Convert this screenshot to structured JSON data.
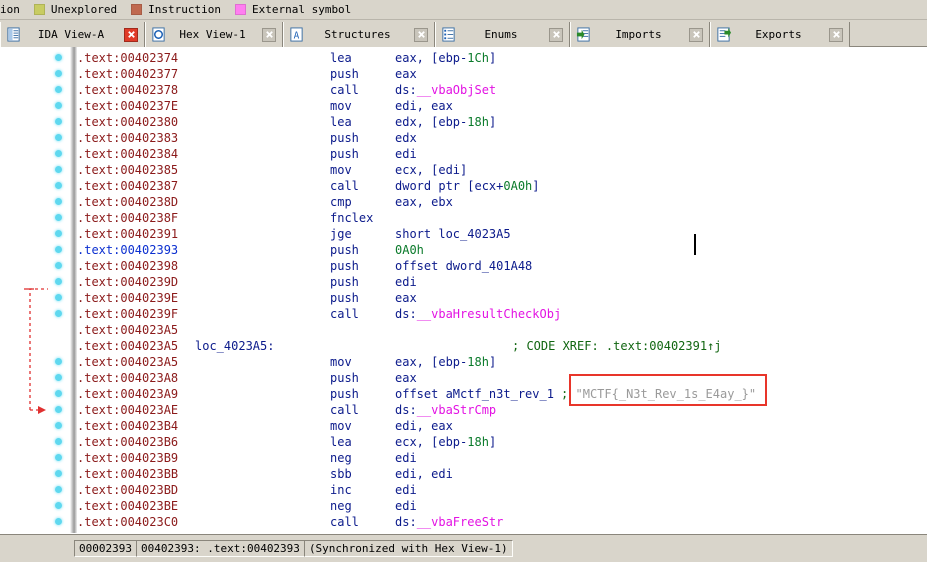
{
  "legend": {
    "truncated_text": "ion",
    "items": [
      {
        "label": "Unexplored",
        "color": "#c8cc62"
      },
      {
        "label": "Instruction",
        "color": "#c0694f"
      },
      {
        "label": "External symbol",
        "color": "#ff7ef0"
      }
    ]
  },
  "tabs": [
    {
      "label": "IDA View-A",
      "icon": "document-list-icon",
      "active": true,
      "close_label": "x"
    },
    {
      "label": "Hex View-1",
      "icon": "hex-circle-icon",
      "active": false,
      "close_label": "x"
    },
    {
      "label": "Structures",
      "icon": "letter-a-icon",
      "active": false,
      "close_label": "x"
    },
    {
      "label": "Enums",
      "icon": "enum-list-icon",
      "active": false,
      "close_label": "x"
    },
    {
      "label": "Imports",
      "icon": "imports-arrow-icon",
      "active": false,
      "close_label": "x"
    },
    {
      "label": "Exports",
      "icon": "exports-arrow-icon",
      "active": false,
      "close_label": "x"
    }
  ],
  "disassembly": {
    "segment": ".text",
    "flag_string": "\"MCTF{_N3t_Rev_1s_E4ay_}\"",
    "xref_comment": "; CODE XREF: .text:00402391↑j",
    "lines": [
      {
        "addr": ".text:00402374",
        "mnem": "lea",
        "ops": [
          {
            "t": "eax, [ebp-",
            "c": "plain"
          },
          {
            "t": "1Ch",
            "c": "num"
          },
          {
            "t": "]",
            "c": "plain"
          }
        ]
      },
      {
        "addr": ".text:00402377",
        "mnem": "push",
        "ops": [
          {
            "t": "eax",
            "c": "plain"
          }
        ]
      },
      {
        "addr": ".text:00402378",
        "mnem": "call",
        "ops": [
          {
            "t": "ds:",
            "c": "plain"
          },
          {
            "t": "__vbaObjSet",
            "c": "ext"
          }
        ]
      },
      {
        "addr": ".text:0040237E",
        "mnem": "mov",
        "ops": [
          {
            "t": "edi, eax",
            "c": "plain"
          }
        ]
      },
      {
        "addr": ".text:00402380",
        "mnem": "lea",
        "ops": [
          {
            "t": "edx, [ebp-",
            "c": "plain"
          },
          {
            "t": "18h",
            "c": "num"
          },
          {
            "t": "]",
            "c": "plain"
          }
        ]
      },
      {
        "addr": ".text:00402383",
        "mnem": "push",
        "ops": [
          {
            "t": "edx",
            "c": "plain"
          }
        ]
      },
      {
        "addr": ".text:00402384",
        "mnem": "push",
        "ops": [
          {
            "t": "edi",
            "c": "plain"
          }
        ]
      },
      {
        "addr": ".text:00402385",
        "mnem": "mov",
        "ops": [
          {
            "t": "ecx, [edi]",
            "c": "plain"
          }
        ]
      },
      {
        "addr": ".text:00402387",
        "mnem": "call",
        "ops": [
          {
            "t": "dword ptr [ecx+",
            "c": "plain"
          },
          {
            "t": "0A0h",
            "c": "num"
          },
          {
            "t": "]",
            "c": "plain"
          }
        ]
      },
      {
        "addr": ".text:0040238D",
        "mnem": "cmp",
        "ops": [
          {
            "t": "eax, ebx",
            "c": "plain"
          }
        ]
      },
      {
        "addr": ".text:0040238F",
        "mnem": "fnclex",
        "ops": []
      },
      {
        "addr": ".text:00402391",
        "mnem": "jge",
        "ops": [
          {
            "t": "short loc_4023A5",
            "c": "plain"
          }
        ]
      },
      {
        "addr": ".text:00402393",
        "current": true,
        "mnem": "push",
        "ops": [
          {
            "t": "0A0h",
            "c": "num"
          }
        ]
      },
      {
        "addr": ".text:00402398",
        "mnem": "push",
        "ops": [
          {
            "t": "offset dword_401A48",
            "c": "plain"
          }
        ]
      },
      {
        "addr": ".text:0040239D",
        "mnem": "push",
        "ops": [
          {
            "t": "edi",
            "c": "plain"
          }
        ]
      },
      {
        "addr": ".text:0040239E",
        "mnem": "push",
        "ops": [
          {
            "t": "eax",
            "c": "plain"
          }
        ]
      },
      {
        "addr": ".text:0040239F",
        "mnem": "call",
        "ops": [
          {
            "t": "ds:",
            "c": "plain"
          },
          {
            "t": "__vbaHresultCheckObj",
            "c": "ext"
          }
        ]
      },
      {
        "addr": ".text:004023A5",
        "mnem": "",
        "ops": []
      },
      {
        "addr": ".text:004023A5",
        "label": "loc_4023A5:",
        "xref": "; CODE XREF: .text:00402391↑j",
        "mnem": "",
        "ops": []
      },
      {
        "addr": ".text:004023A5",
        "mnem": "mov",
        "ops": [
          {
            "t": "eax, [ebp-",
            "c": "plain"
          },
          {
            "t": "18h",
            "c": "num"
          },
          {
            "t": "]",
            "c": "plain"
          }
        ]
      },
      {
        "addr": ".text:004023A8",
        "mnem": "push",
        "ops": [
          {
            "t": "eax",
            "c": "plain"
          }
        ]
      },
      {
        "addr": ".text:004023A9",
        "mnem": "push",
        "ops": [
          {
            "t": "offset aMctf_n3t_rev_1",
            "c": "plain"
          }
        ],
        "strcmt": "\"MCTF{_N3t_Rev_1s_E4ay_}\"",
        "sep": ";"
      },
      {
        "addr": ".text:004023AE",
        "mnem": "call",
        "ops": [
          {
            "t": "ds:",
            "c": "plain"
          },
          {
            "t": "__vbaStrCmp",
            "c": "ext"
          }
        ]
      },
      {
        "addr": ".text:004023B4",
        "mnem": "mov",
        "ops": [
          {
            "t": "edi, eax",
            "c": "plain"
          }
        ]
      },
      {
        "addr": ".text:004023B6",
        "mnem": "lea",
        "ops": [
          {
            "t": "ecx, [ebp-",
            "c": "plain"
          },
          {
            "t": "18h",
            "c": "num"
          },
          {
            "t": "]",
            "c": "plain"
          }
        ]
      },
      {
        "addr": ".text:004023B9",
        "mnem": "neg",
        "ops": [
          {
            "t": "edi",
            "c": "plain"
          }
        ]
      },
      {
        "addr": ".text:004023BB",
        "mnem": "sbb",
        "ops": [
          {
            "t": "edi, edi",
            "c": "plain"
          }
        ]
      },
      {
        "addr": ".text:004023BD",
        "mnem": "inc",
        "ops": [
          {
            "t": "edi",
            "c": "plain"
          }
        ]
      },
      {
        "addr": ".text:004023BE",
        "mnem": "neg",
        "ops": [
          {
            "t": "edi",
            "c": "plain"
          }
        ]
      },
      {
        "addr": ".text:004023C0",
        "mnem": "call",
        "ops": [
          {
            "t": "ds:",
            "c": "plain"
          },
          {
            "t": "__vbaFreeStr",
            "c": "ext"
          }
        ]
      }
    ]
  },
  "status_bar": {
    "file_offset": "00002393",
    "address": "00402393: .text:00402393",
    "sync_text": "(Synchronized with Hex View-1)"
  },
  "colors": {
    "address": "#8b1a1a",
    "current_address": "#0b2fd0",
    "mnemonic": "#0b1a8b",
    "number": "#0a7a2a",
    "external_symbol": "#e312e3",
    "comment": "#116611",
    "string_comment": "#9a9a9a",
    "highlight_border": "#e8352a",
    "jump_arrow": "#e03030",
    "nav_dot": "#5fd8ef",
    "chrome": "#d9d5cb"
  }
}
